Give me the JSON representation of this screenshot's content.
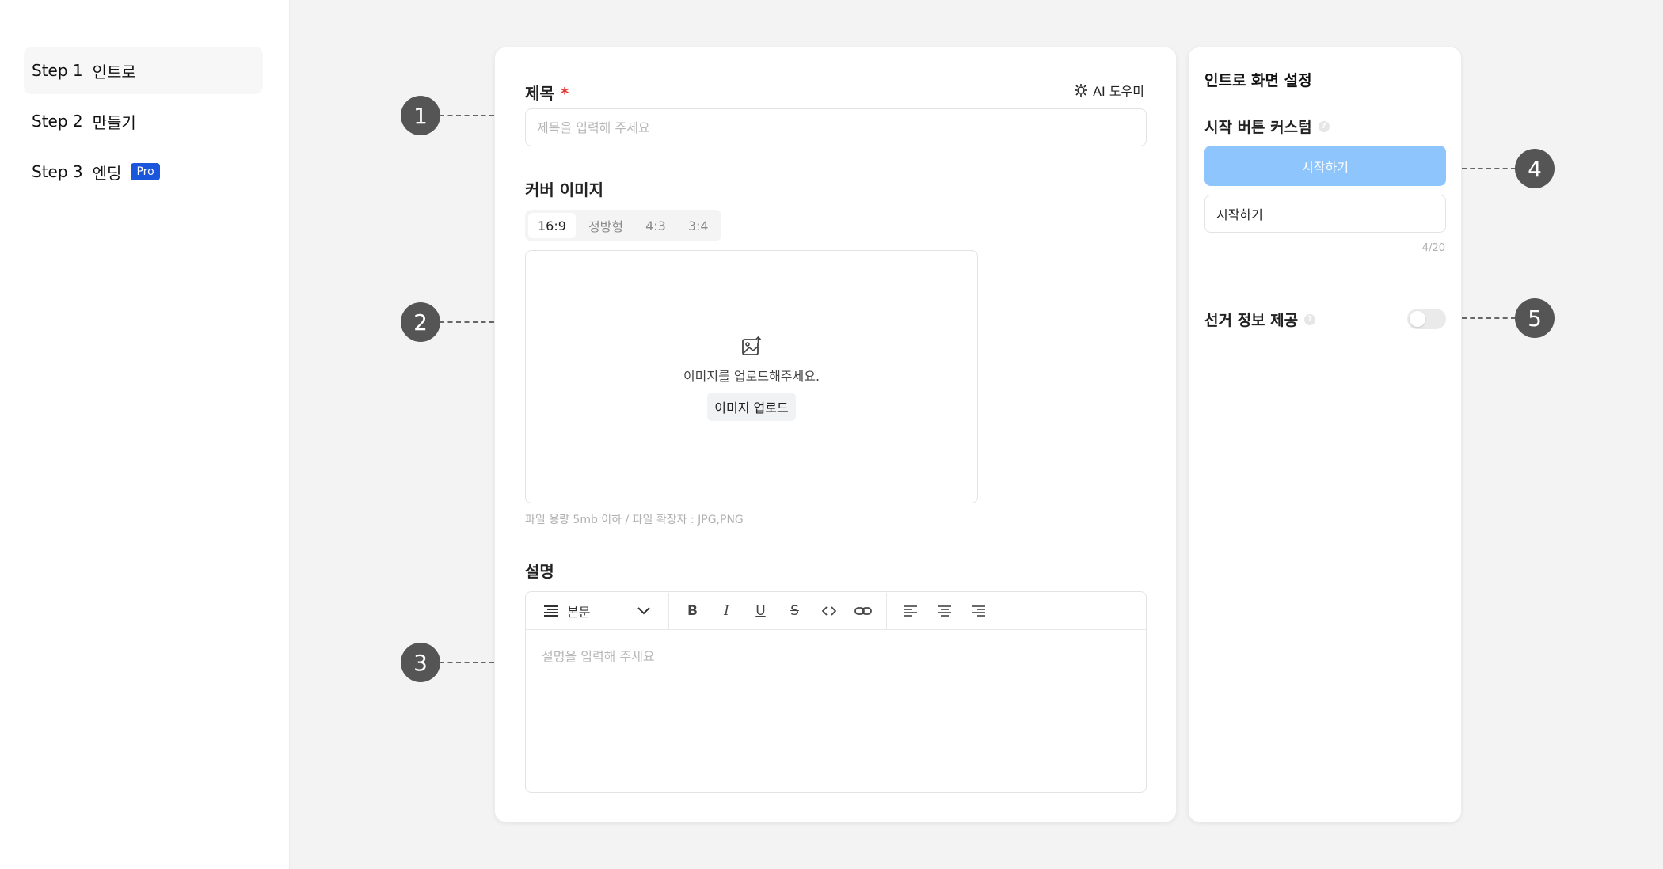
{
  "sidebar": {
    "steps": [
      {
        "num": "Step 1",
        "label": "인트로"
      },
      {
        "num": "Step 2",
        "label": "만들기"
      },
      {
        "num": "Step 3",
        "label": "엔딩",
        "badge": "Pro"
      }
    ]
  },
  "main": {
    "title_label": "제목",
    "required_mark": "*",
    "ai_helper": "AI 도우미",
    "title_placeholder": "제목을 입력해 주세요",
    "cover_label": "커버 이미지",
    "ratios": [
      "16:9",
      "정방형",
      "4:3",
      "3:4"
    ],
    "upload_text": "이미지를 업로드해주세요.",
    "upload_button": "이미지 업로드",
    "file_hint": "파일 용량 5mb 이하 / 파일 확장자 : JPG,PNG",
    "desc_label": "설명",
    "block_type": "본문",
    "desc_placeholder": "설명을 입력해 주세요"
  },
  "side": {
    "title": "인트로 화면 설정",
    "start_label": "시작 버튼 커스텀",
    "start_preview": "시작하기",
    "start_value": "시작하기",
    "counter": "4/20",
    "election_label": "선거 정보 제공",
    "election_on": false
  },
  "callouts": [
    "1",
    "2",
    "3",
    "4",
    "5"
  ],
  "colors": {
    "accent": "#1a56db",
    "preview_button": "#8ec5fc",
    "required": "#e53935"
  }
}
